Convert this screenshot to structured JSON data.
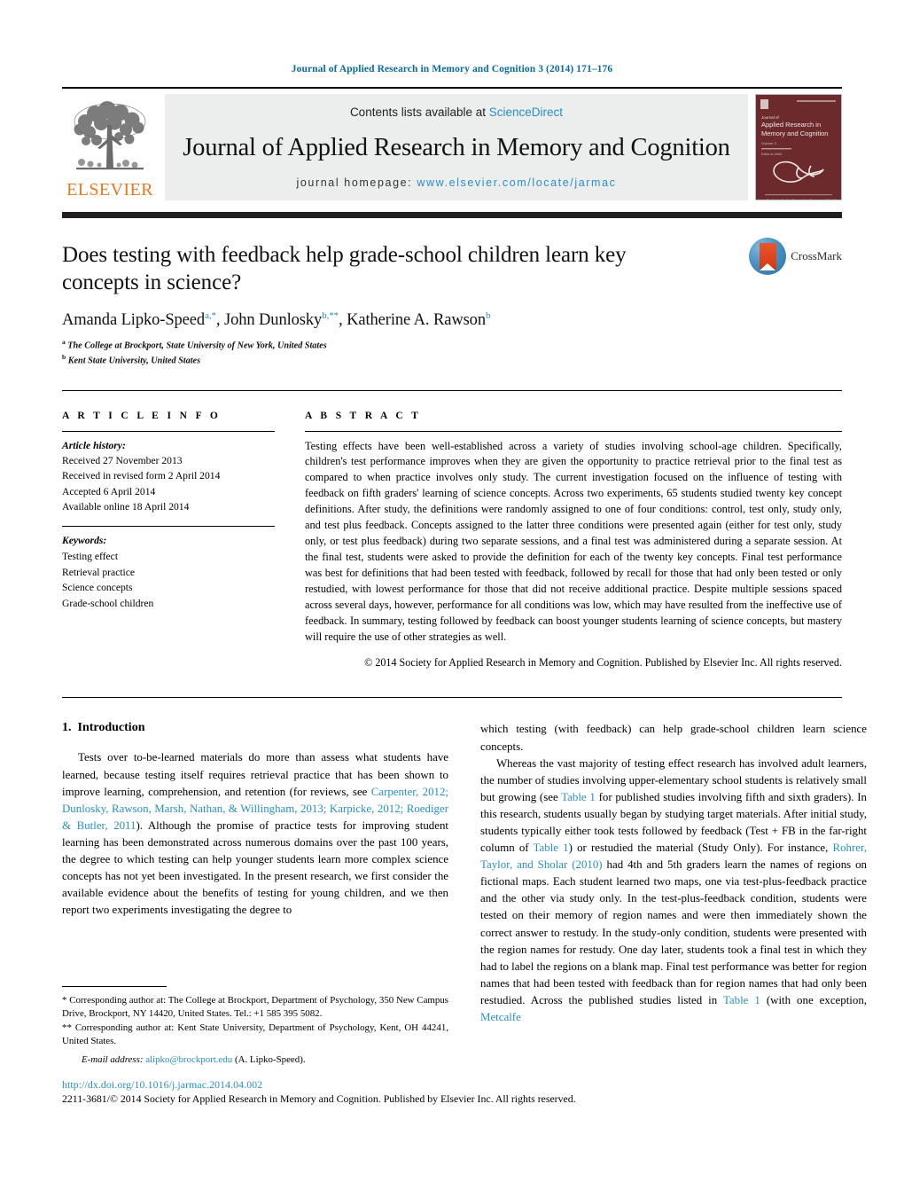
{
  "running_head": "Journal of Applied Research in Memory and Cognition 3 (2014) 171–176",
  "masthead": {
    "contents_prefix": "Contents lists available at ",
    "sciencedirect": "ScienceDirect",
    "journal_title": "Journal of Applied Research in Memory and Cognition",
    "homepage_prefix": "journal homepage: ",
    "homepage_url": "www.elsevier.com/locate/jarmac",
    "publisher": "ELSEVIER",
    "link_color": "#2a8fc4",
    "orange": "#E87722",
    "cover": {
      "line1": "Journal of",
      "line2": "Applied Research in",
      "line3": "Memory and Cognition",
      "bg": "#6d2a2c"
    }
  },
  "article": {
    "title": "Does testing with feedback help grade-school children learn key concepts in science?",
    "authors_plain": "Amanda Lipko-Speed a,*, John Dunlosky b,**, Katherine A. Rawson b",
    "authors": [
      {
        "name": "Amanda Lipko-Speed",
        "marks": "a,*"
      },
      {
        "name": "John Dunlosky",
        "marks": "b,**"
      },
      {
        "name": "Katherine A. Rawson",
        "marks": "b"
      }
    ],
    "affiliations": [
      {
        "mark": "a",
        "text": "The College at Brockport, State University of New York, United States"
      },
      {
        "mark": "b",
        "text": "Kent State University, United States"
      }
    ],
    "crossmark_label": "CrossMark"
  },
  "info": {
    "heading": "A R T I C L E   I N F O",
    "history_label": "Article history:",
    "history": [
      "Received 27 November 2013",
      "Received in revised form 2 April 2014",
      "Accepted 6 April 2014",
      "Available online 18 April 2014"
    ],
    "keywords_label": "Keywords:",
    "keywords": [
      "Testing effect",
      "Retrieval practice",
      "Science concepts",
      "Grade-school children"
    ]
  },
  "abstract": {
    "heading": "A B S T R A C T",
    "text": "Testing effects have been well-established across a variety of studies involving school-age children. Specifically, children's test performance improves when they are given the opportunity to practice retrieval prior to the final test as compared to when practice involves only study. The current investigation focused on the influence of testing with feedback on fifth graders' learning of science concepts. Across two experiments, 65 students studied twenty key concept definitions. After study, the definitions were randomly assigned to one of four conditions: control, test only, study only, and test plus feedback. Concepts assigned to the latter three conditions were presented again (either for test only, study only, or test plus feedback) during two separate sessions, and a final test was administered during a separate session. At the final test, students were asked to provide the definition for each of the twenty key concepts. Final test performance was best for definitions that had been tested with feedback, followed by recall for those that had only been tested or only restudied, with lowest performance for those that did not receive additional practice. Despite multiple sessions spaced across several days, however, performance for all conditions was low, which may have resulted from the ineffective use of feedback. In summary, testing followed by feedback can boost younger students learning of science concepts, but mastery will require the use of other strategies as well.",
    "copyright": "© 2014 Society for Applied Research in Memory and Cognition. Published by Elsevier Inc. All rights reserved."
  },
  "body": {
    "section_number": "1.",
    "section_title": "Introduction",
    "left_para_1_a": "Tests over to-be-learned materials do more than assess what students have learned, because testing itself requires retrieval practice that has been shown to improve learning, comprehension, and retention (for reviews, see ",
    "left_para_1_refs": "Carpenter, 2012; Dunlosky, Rawson, Marsh, Nathan, & Willingham, 2013; Karpicke, 2012; Roediger & Butler, 2011",
    "left_para_1_b": "). Although the promise of practice tests for improving student learning has been demonstrated across numerous domains over the past 100 years, the degree to which testing can help younger students learn more complex science concepts has not yet been investigated. In the present research, we first consider the available evidence about the benefits of testing for young children, and we then report two experiments investigating the degree to",
    "right_para_1_cont": "which testing (with feedback) can help grade-school children learn science concepts.",
    "right_para_2_a": "Whereas the vast majority of testing effect research has involved adult learners, the number of studies involving upper-elementary school students is relatively small but growing (see ",
    "right_ref_table1_a": "Table 1",
    "right_para_2_b": " for published studies involving fifth and sixth graders). In this research, students usually began by studying target materials. After initial study, students typically either took tests followed by feedback (Test + FB in the far-right column of ",
    "right_ref_table1_b": "Table 1",
    "right_para_2_c": ") or restudied the material (Study Only). For instance, ",
    "right_ref_rohrer": "Rohrer, Taylor, and Sholar (2010)",
    "right_para_2_d": " had 4th and 5th graders learn the names of regions on fictional maps. Each student learned two maps, one via test-plus-feedback practice and the other via study only. In the test-plus-feedback condition, students were tested on their memory of region names and were then immediately shown the correct answer to restudy. In the study-only condition, students were presented with the region names for restudy. One day later, students took a final test in which they had to label the regions on a blank map. Final test performance was better for region names that had been tested with feedback than for region names that had only been restudied. Across the published studies listed in ",
    "right_ref_table1_c": "Table 1",
    "right_para_2_e": " (with one exception, ",
    "right_ref_metcalfe": "Metcalfe"
  },
  "footnotes": {
    "star1": "* Corresponding author at: The College at Brockport, Department of Psychology, 350 New Campus Drive, Brockport, NY 14420, United States. Tel.: +1 585 395 5082.",
    "star2": "** Corresponding author at: Kent State University, Department of Psychology, Kent, OH 44241, United States.",
    "email_label": "E-mail address:",
    "email": "alipko@brockport.edu",
    "email_suffix": "(A. Lipko-Speed)."
  },
  "footer": {
    "doi": "http://dx.doi.org/10.1016/j.jarmac.2014.04.002",
    "issn_line": "2211-3681/© 2014 Society for Applied Research in Memory and Cognition. Published by Elsevier Inc. All rights reserved."
  }
}
